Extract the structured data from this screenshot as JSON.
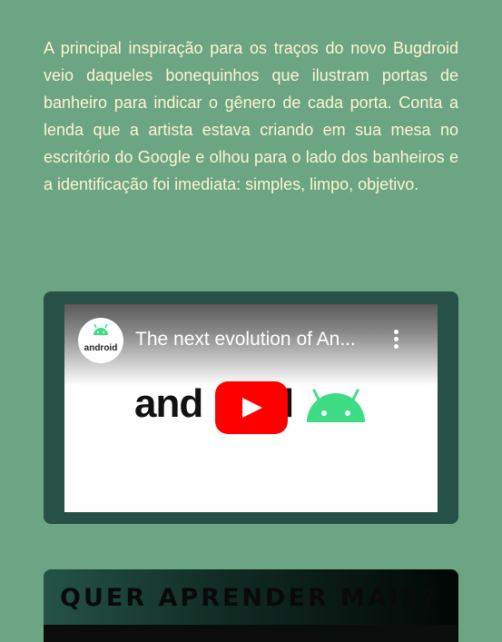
{
  "article": {
    "paragraph": "A principal inspiração para os traços do novo Bugdroid veio daqueles bonequinhos que ilustram portas de banheiro para indicar o gênero de cada porta. Conta a lenda que a artista estava criando em sua mesa no escritório do Google e olhou para o lado dos banheiros e a identificação foi imediata: simples, limpo, objetivo."
  },
  "video": {
    "title": "The next evolution of An...",
    "channel_avatar_text": "android",
    "wordmark_start": "and",
    "wordmark_end": "l",
    "play_icon": "play-icon",
    "more_icon": "more-vert-icon",
    "accent_color": "#ff0000",
    "android_green": "#3ddc84"
  },
  "learn_more": {
    "title": "QUER APRENDER MAIS?"
  }
}
